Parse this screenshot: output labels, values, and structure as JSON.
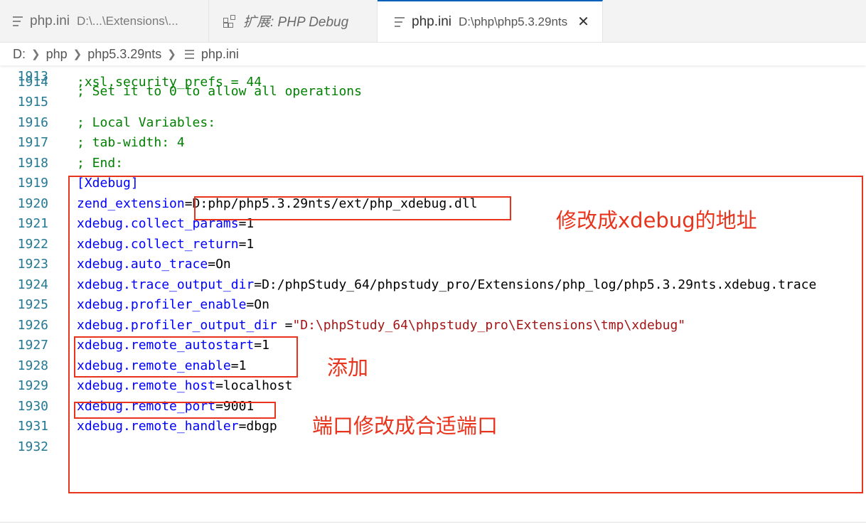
{
  "tabs": [
    {
      "title": "php.ini",
      "desc": "D:\\...\\Extensions\\...",
      "active": false,
      "icon": "file-lines-icon"
    },
    {
      "title": "扩展: PHP Debug",
      "desc": "",
      "active": false,
      "icon": "extensions-icon"
    },
    {
      "title": "php.ini",
      "desc": "D:\\php\\php5.3.29nts",
      "active": true,
      "icon": "file-lines-icon",
      "close": "✕"
    }
  ],
  "breadcrumb": [
    "D:",
    "php",
    "php5.3.29nts",
    "php.ini"
  ],
  "editor": {
    "top_partial": {
      "number": "1913",
      "text": "; Set it to 0 to allow all operations"
    },
    "lines": [
      {
        "number": "1914",
        "parts": [
          {
            "text": ";xsl.security_prefs = 44",
            "kind": "comment"
          }
        ]
      },
      {
        "number": "1915",
        "parts": []
      },
      {
        "number": "1916",
        "parts": [
          {
            "text": "; Local Variables:",
            "kind": "comment"
          }
        ]
      },
      {
        "number": "1917",
        "parts": [
          {
            "text": "; tab-width: 4",
            "kind": "comment"
          }
        ]
      },
      {
        "number": "1918",
        "parts": [
          {
            "text": "; End:",
            "kind": "comment"
          }
        ]
      },
      {
        "number": "1919",
        "parts": [
          {
            "text": "[Xdebug]",
            "kind": "key"
          }
        ]
      },
      {
        "number": "1920",
        "parts": [
          {
            "text": "zend_extension",
            "kind": "key"
          },
          {
            "text": "=D:php/php5.3.29nts/ext/php_xdebug.dll",
            "kind": "val"
          }
        ]
      },
      {
        "number": "1921",
        "parts": [
          {
            "text": "xdebug.collect_params",
            "kind": "key"
          },
          {
            "text": "=1",
            "kind": "val"
          }
        ]
      },
      {
        "number": "1922",
        "parts": [
          {
            "text": "xdebug.collect_return",
            "kind": "key"
          },
          {
            "text": "=1",
            "kind": "val"
          }
        ]
      },
      {
        "number": "1923",
        "parts": [
          {
            "text": "xdebug.auto_trace",
            "kind": "key"
          },
          {
            "text": "=On",
            "kind": "val"
          }
        ]
      },
      {
        "number": "1924",
        "parts": [
          {
            "text": "xdebug.trace_output_dir",
            "kind": "key"
          },
          {
            "text": "=D:/phpStudy_64/phpstudy_pro/Extensions/php_log/php5.3.29nts.xdebug.trace",
            "kind": "val"
          }
        ]
      },
      {
        "number": "1925",
        "parts": [
          {
            "text": "xdebug.profiler_enable",
            "kind": "key"
          },
          {
            "text": "=On",
            "kind": "val"
          }
        ]
      },
      {
        "number": "1926",
        "parts": [
          {
            "text": "xdebug.profiler_output_dir",
            "kind": "key"
          },
          {
            "text": " =",
            "kind": "val"
          },
          {
            "text": "\"D:\\phpStudy_64\\phpstudy_pro\\Extensions\\tmp\\xdebug\"",
            "kind": "str"
          }
        ]
      },
      {
        "number": "1927",
        "parts": [
          {
            "text": "xdebug.remote_autostart",
            "kind": "key"
          },
          {
            "text": "=1",
            "kind": "val"
          }
        ]
      },
      {
        "number": "1928",
        "parts": [
          {
            "text": "xdebug.remote_enable",
            "kind": "key"
          },
          {
            "text": "=1",
            "kind": "val"
          }
        ]
      },
      {
        "number": "1929",
        "parts": [
          {
            "text": "xdebug.remote_host",
            "kind": "key"
          },
          {
            "text": "=localhost",
            "kind": "val"
          }
        ]
      },
      {
        "number": "1930",
        "parts": [
          {
            "text": "xdebug.remote_port",
            "kind": "key"
          },
          {
            "text": "=9001",
            "kind": "val"
          }
        ]
      },
      {
        "number": "1931",
        "parts": [
          {
            "text": "xdebug.remote_handler",
            "kind": "key"
          },
          {
            "text": "=dbgp",
            "kind": "val"
          }
        ]
      },
      {
        "number": "1932",
        "parts": []
      }
    ]
  },
  "annotations": {
    "note_address": "修改成xdebug的地址",
    "note_add": "添加",
    "note_port": "端口修改成合适端口",
    "color": "#e8341c"
  },
  "colors": {
    "comment": "#008000",
    "key": "#0000ff",
    "string": "#a31515",
    "line_number": "#237893"
  }
}
